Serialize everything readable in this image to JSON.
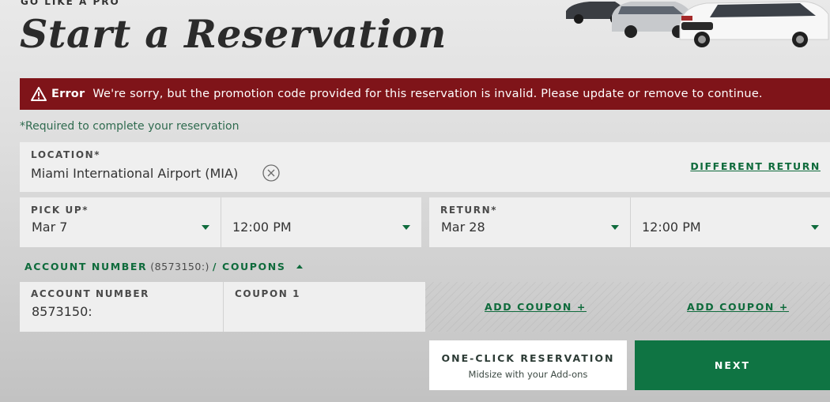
{
  "header": {
    "eyebrow": "GO LIKE A PRO",
    "title": "Start a Reservation"
  },
  "error": {
    "icon": "warning-icon",
    "label": "Error",
    "message": "We're sorry, but the promotion code provided for this reservation is invalid. Please update or remove to continue.",
    "color": "#7f1419"
  },
  "required_note": "*Required to complete your reservation",
  "location": {
    "label": "LOCATION*",
    "value": "Miami International Airport (MIA)",
    "clear_icon": "close-circle-icon",
    "different_return": "DIFFERENT RETURN"
  },
  "pickup": {
    "label": "PICK UP*",
    "date": "Mar 7",
    "time": "12:00 PM"
  },
  "return": {
    "label": "RETURN*",
    "date": "Mar 28",
    "time": "12:00 PM"
  },
  "account_toggle": {
    "prefix": "ACCOUNT NUMBER",
    "number": "(8573150:)",
    "suffix": "/ COUPONS"
  },
  "account": {
    "label": "ACCOUNT NUMBER",
    "value": "8573150:"
  },
  "coupon1": {
    "label": "COUPON 1",
    "value": ""
  },
  "add_coupon_label": "ADD COUPON +",
  "one_click": {
    "title": "ONE-CLICK RESERVATION",
    "subtitle": "Midsize with your Add-ons"
  },
  "next_label": "NEXT",
  "colors": {
    "accent_green": "#0f7443",
    "link_green": "#0f6b3c",
    "error_red": "#7f1419"
  }
}
